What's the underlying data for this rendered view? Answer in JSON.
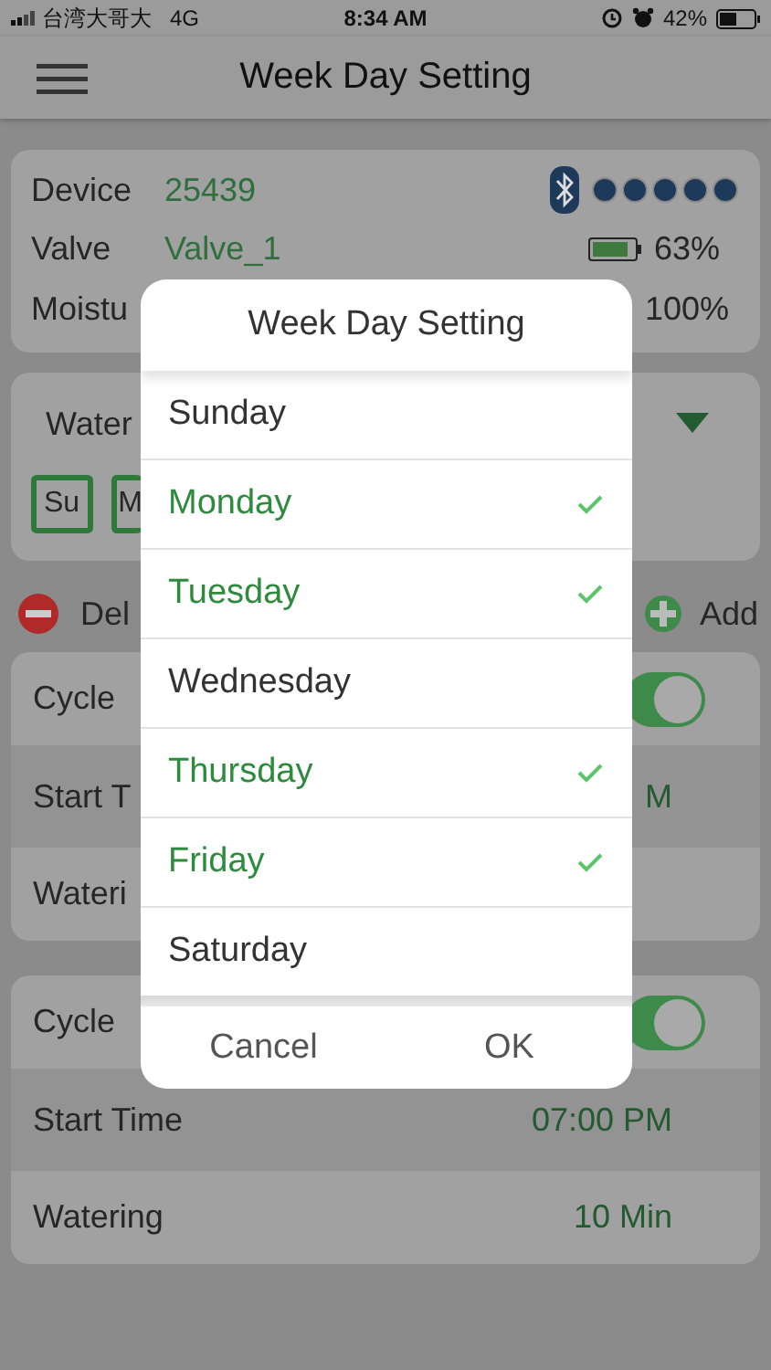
{
  "status_bar": {
    "carrier": "台湾大哥大",
    "network": "4G",
    "time": "8:34 AM",
    "battery": "42%"
  },
  "header": {
    "title": "Week Day Setting"
  },
  "device_card": {
    "rows": [
      {
        "label": "Device",
        "value": "25439"
      },
      {
        "label": "Valve",
        "value": "Valve_1"
      },
      {
        "label": "Moistu"
      }
    ],
    "battery": "63%",
    "moisture": "100%"
  },
  "schedule_card": {
    "label": "Water",
    "days": [
      "Su",
      "M"
    ]
  },
  "actions": {
    "delete": "Del",
    "add": "Add"
  },
  "cycles": [
    {
      "title": "Cycle",
      "on": true,
      "rows": [
        {
          "label": "Start T",
          "value": "M"
        },
        {
          "label": "Wateri"
        }
      ]
    },
    {
      "title": "Cycle",
      "on": true,
      "rows": [
        {
          "label": "Start Time",
          "value": "07:00 PM"
        },
        {
          "label": "Watering",
          "value": "10 Min"
        }
      ]
    }
  ],
  "dialog": {
    "title": "Week Day Setting",
    "days": [
      {
        "label": "Sunday",
        "selected": false
      },
      {
        "label": "Monday",
        "selected": true
      },
      {
        "label": "Tuesday",
        "selected": true
      },
      {
        "label": "Wednesday",
        "selected": false
      },
      {
        "label": "Thursday",
        "selected": true
      },
      {
        "label": "Friday",
        "selected": true
      },
      {
        "label": "Saturday",
        "selected": false
      }
    ],
    "buttons": [
      "Cancel",
      "OK"
    ]
  }
}
